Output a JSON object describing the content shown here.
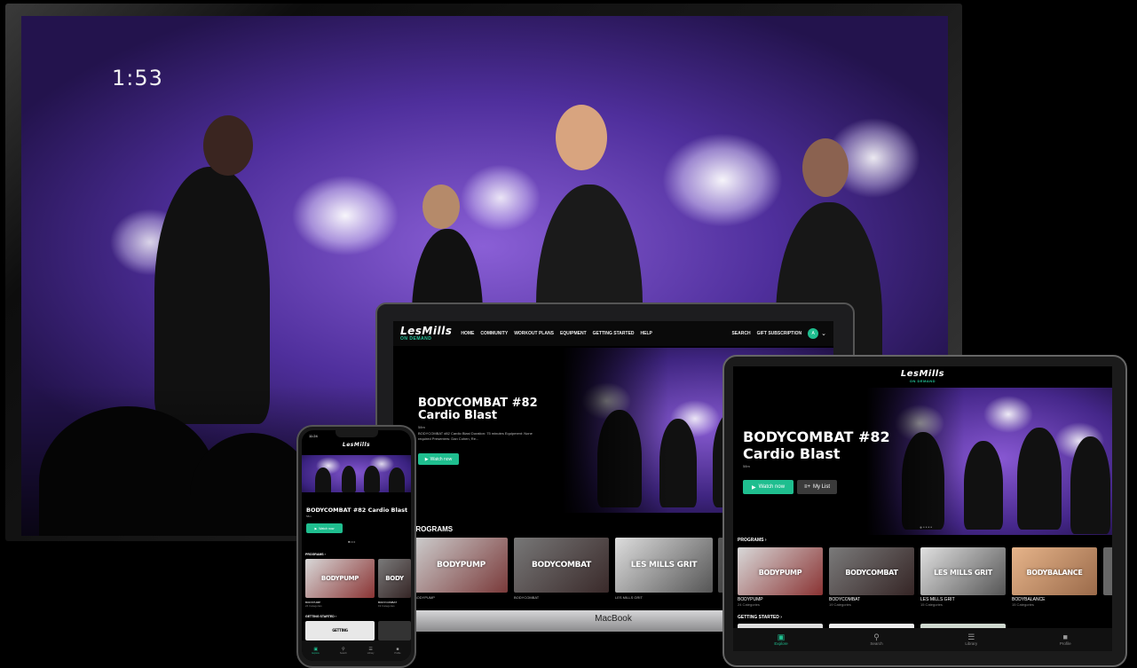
{
  "tv": {
    "timer": "1:53"
  },
  "brand": {
    "name": "LesMills",
    "sub": "ON DEMAND"
  },
  "laptop": {
    "nav": [
      "HOME",
      "COMMUNITY",
      "WORKOUT PLANS",
      "EQUIPMENT",
      "GETTING STARTED",
      "HELP"
    ],
    "search": "SEARCH",
    "gift": "GIFT SUBSCRIPTION",
    "avatar": "A",
    "hero_title_1": "BODYCOMBAT #82",
    "hero_title_2": "Cardio Blast",
    "hero_meta": "58m",
    "hero_desc": "BODYCOMBAT #82 Cardio Blast Duration: 75 minutes Equipment: None required Presenters: Dan Cohen, Re...",
    "watch_now": "Watch now",
    "programs_heading": "PROGRAMS",
    "tiles": [
      "BODYPUMP",
      "BODYCOMBAT",
      "LES MILLS GRIT"
    ],
    "captions": [
      "BODYPUMP",
      "BODYCOMBAT",
      "LES MILLS GRIT"
    ],
    "base_label": "MacBook"
  },
  "tablet": {
    "hero_title_1": "BODYCOMBAT #82",
    "hero_title_2": "Cardio Blast",
    "hero_meta": "58m",
    "watch_now": "Watch now",
    "my_list": "My List",
    "programs_heading": "PROGRAMS",
    "programs": [
      {
        "tile": "BODYPUMP",
        "name": "BODYPUMP",
        "sub": "24 Categories"
      },
      {
        "tile": "BODYCOMBAT",
        "name": "BODYCOMBAT",
        "sub": "19 Categories"
      },
      {
        "tile": "LES MILLS GRIT",
        "name": "LES MILLS GRIT",
        "sub": "15 Categories"
      },
      {
        "tile": "BODYBALANCE",
        "name": "BODYBALANCE",
        "sub": "15 Categories"
      }
    ],
    "getting_started": "GETTING STARTED",
    "tabs": [
      "Explore",
      "Search",
      "Library",
      "Profile"
    ]
  },
  "phone": {
    "time": "11:24",
    "hero_title": "BODYCOMBAT #82 Cardio Blast",
    "hero_meta": "58m",
    "watch_now": "Watch now",
    "programs_heading": "PROGRAMS",
    "programs": [
      {
        "tile": "BODYPUMP",
        "name": "BODYPUMP",
        "sub": "24 Categories"
      },
      {
        "tile": "BODY",
        "name": "BODYCOMBAT",
        "sub": "19 Categories"
      }
    ],
    "getting_started": "GETTING STARTED",
    "getting_tile": "GETTING",
    "tabs": [
      "Explore",
      "Search",
      "Library",
      "Profile"
    ]
  },
  "colors": {
    "accent": "#1fbe8f",
    "background": "#000000"
  },
  "icons": [
    "play-icon",
    "plus-list-icon",
    "search-icon",
    "library-icon",
    "profile-icon",
    "explore-icon",
    "chevron-down-icon"
  ]
}
